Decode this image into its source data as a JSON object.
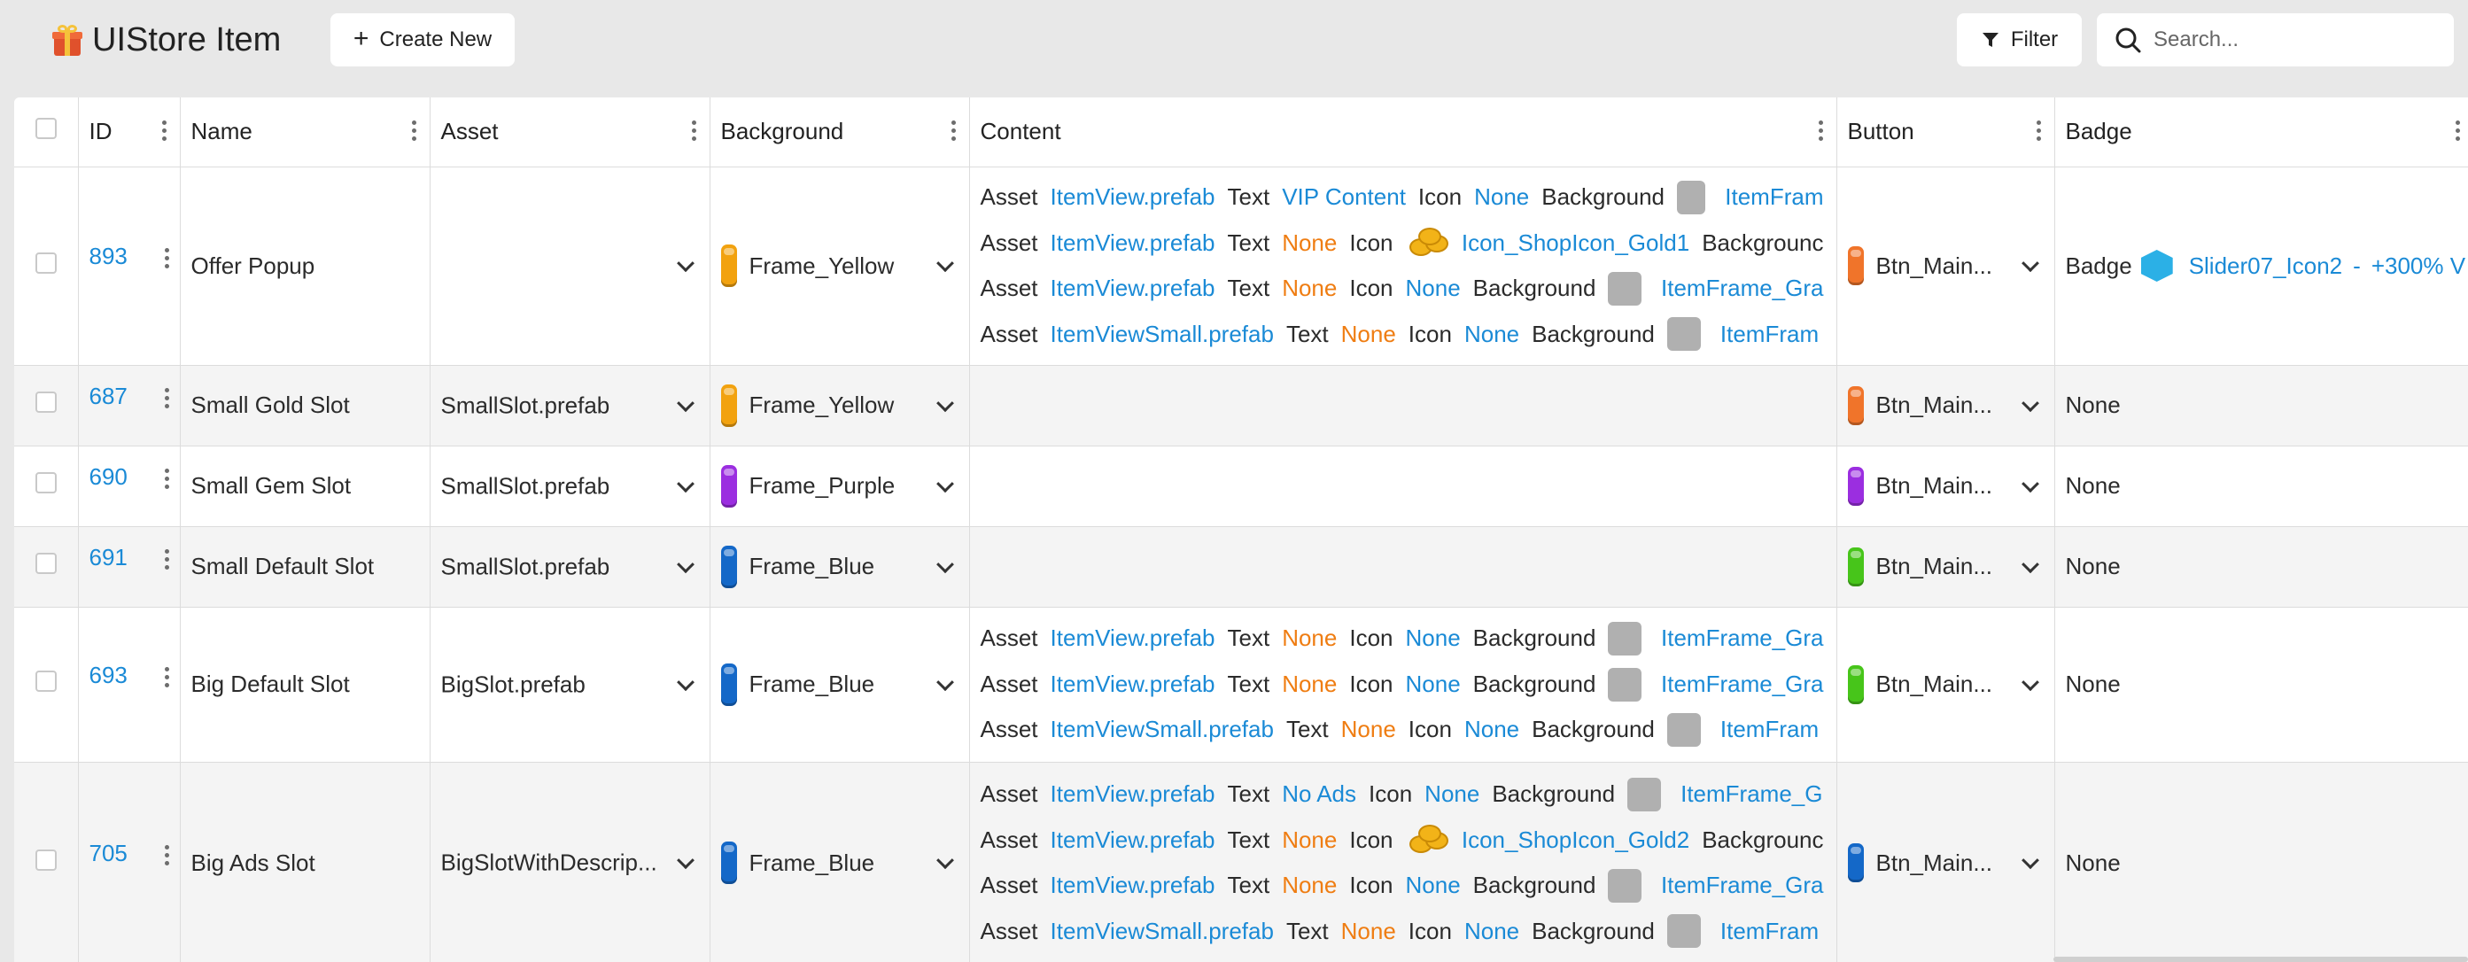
{
  "header": {
    "title": "UIStore Item",
    "create_label": "Create New",
    "filter_label": "Filter",
    "search_placeholder": "Search..."
  },
  "columns": {
    "id": "ID",
    "name": "Name",
    "asset": "Asset",
    "background": "Background",
    "content": "Content",
    "button": "Button",
    "badge": "Badge"
  },
  "colors": {
    "yellow": "#f2a20f",
    "purple": "#9b2ee0",
    "blue": "#1468c8",
    "orange": "#f0742a",
    "green": "#47c51a",
    "link": "#1a8ad6",
    "none_orange": "#ef7d12"
  },
  "rows": [
    {
      "id": "893",
      "name": "Offer Popup",
      "asset": "",
      "background": "Frame_Yellow",
      "bg_color": "yellow",
      "button": "Btn_Main...",
      "button_color": "orange",
      "badge": {
        "key": "Badge",
        "icon": "gem-icon",
        "value": "Slider07_Icon2",
        "sep": "-",
        "extra": "+300% V"
      },
      "content": [
        {
          "asset": "ItemView.prefab",
          "text": "VIP Content",
          "text_none": false,
          "icon": "None",
          "icon_img": false,
          "bg": "ItemFram"
        },
        {
          "asset": "ItemView.prefab",
          "text": "None",
          "text_none": true,
          "icon": "Icon_ShopIcon_Gold1",
          "icon_img": true,
          "bg": ""
        },
        {
          "asset": "ItemView.prefab",
          "text": "None",
          "text_none": true,
          "icon": "None",
          "icon_img": false,
          "bg": "ItemFrame_Gra"
        },
        {
          "asset": "ItemViewSmall.prefab",
          "text": "None",
          "text_none": true,
          "icon": "None",
          "icon_img": false,
          "bg": "ItemFram"
        }
      ]
    },
    {
      "id": "687",
      "name": "Small Gold Slot",
      "asset": "SmallSlot.prefab",
      "background": "Frame_Yellow",
      "bg_color": "yellow",
      "button": "Btn_Main...",
      "button_color": "orange",
      "badge_none": "None",
      "content": []
    },
    {
      "id": "690",
      "name": "Small Gem Slot",
      "asset": "SmallSlot.prefab",
      "background": "Frame_Purple",
      "bg_color": "purple",
      "button": "Btn_Main...",
      "button_color": "purple",
      "badge_none": "None",
      "content": []
    },
    {
      "id": "691",
      "name": "Small Default Slot",
      "asset": "SmallSlot.prefab",
      "background": "Frame_Blue",
      "bg_color": "blue",
      "button": "Btn_Main...",
      "button_color": "green",
      "badge_none": "None",
      "content": []
    },
    {
      "id": "693",
      "name": "Big Default Slot",
      "asset": "BigSlot.prefab",
      "background": "Frame_Blue",
      "bg_color": "blue",
      "button": "Btn_Main...",
      "button_color": "green",
      "badge_none": "None",
      "content": [
        {
          "asset": "ItemView.prefab",
          "text": "None",
          "text_none": true,
          "icon": "None",
          "icon_img": false,
          "bg": "ItemFrame_Gra"
        },
        {
          "asset": "ItemView.prefab",
          "text": "None",
          "text_none": true,
          "icon": "None",
          "icon_img": false,
          "bg": "ItemFrame_Gra"
        },
        {
          "asset": "ItemViewSmall.prefab",
          "text": "None",
          "text_none": true,
          "icon": "None",
          "icon_img": false,
          "bg": "ItemFram"
        }
      ]
    },
    {
      "id": "705",
      "name": "Big Ads Slot",
      "asset": "BigSlotWithDescrip...",
      "background": "Frame_Blue",
      "bg_color": "blue",
      "button": "Btn_Main...",
      "button_color": "blue",
      "badge_none": "None",
      "content": [
        {
          "asset": "ItemView.prefab",
          "text": "No Ads",
          "text_none": false,
          "icon": "None",
          "icon_img": false,
          "bg": "ItemFrame_G"
        },
        {
          "asset": "ItemView.prefab",
          "text": "None",
          "text_none": true,
          "icon": "Icon_ShopIcon_Gold2",
          "icon_img": true,
          "bg": ""
        },
        {
          "asset": "ItemView.prefab",
          "text": "None",
          "text_none": true,
          "icon": "None",
          "icon_img": false,
          "bg": "ItemFrame_Gra"
        },
        {
          "asset": "ItemViewSmall.prefab",
          "text": "None",
          "text_none": true,
          "icon": "None",
          "icon_img": false,
          "bg": "ItemFram"
        }
      ]
    }
  ],
  "content_keys": {
    "asset": "Asset",
    "text": "Text",
    "icon": "Icon",
    "background": "Background"
  },
  "truncated_bg_word": "Backgrounc"
}
